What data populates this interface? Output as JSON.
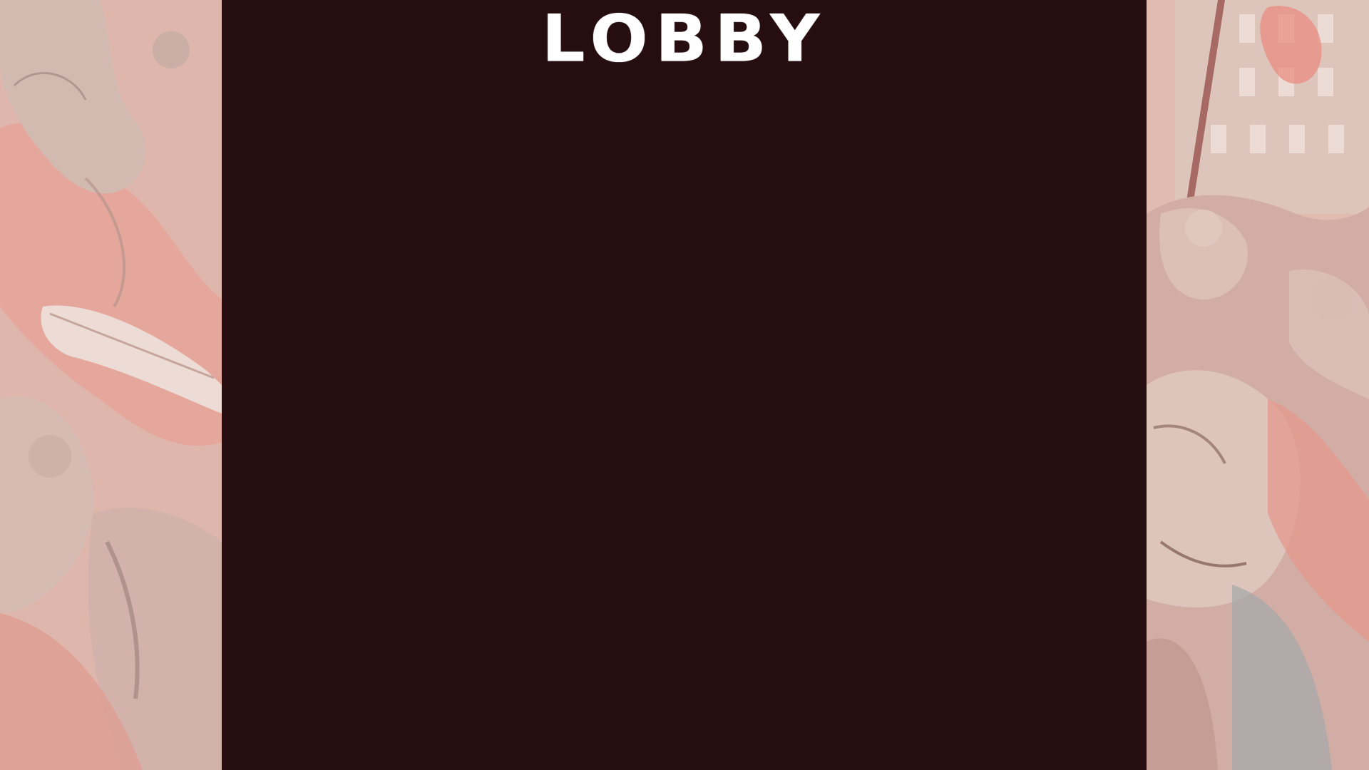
{
  "lobby": {
    "title": "LOBBY"
  },
  "background": {
    "left_art": "zombie-horde-illustration",
    "right_art": "zombie-horde-street-illustration"
  },
  "colors": {
    "panel": "#250d10",
    "title": "#ffffff",
    "art_tint": "#e8b4a8"
  }
}
